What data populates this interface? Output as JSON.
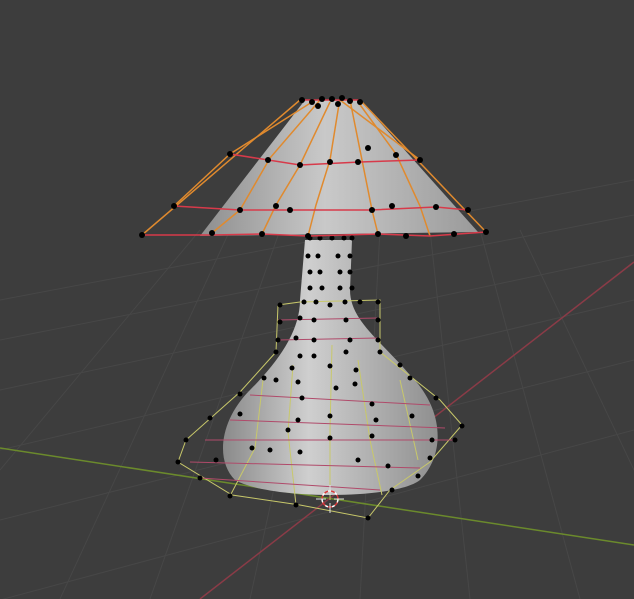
{
  "viewport": {
    "background": "#3d3d3d",
    "grid_color": "#474747",
    "x_axis_color": "#8a3b47",
    "y_axis_color": "#6b8a2c"
  },
  "scene": {
    "objects": [
      {
        "name": "lamp-shade",
        "type": "cone",
        "cage_colors": [
          "#e08a2e",
          "#d83a4a"
        ]
      },
      {
        "name": "lamp-base",
        "type": "vase",
        "cage_colors": [
          "#c8c86a",
          "#b04a6a"
        ]
      }
    ],
    "shading_color": "#bcbcbc",
    "vertex_color": "#000000",
    "cursor": {
      "icon": "3d-cursor-icon",
      "colors": [
        "#ffffff",
        "#d83a3a"
      ]
    }
  }
}
